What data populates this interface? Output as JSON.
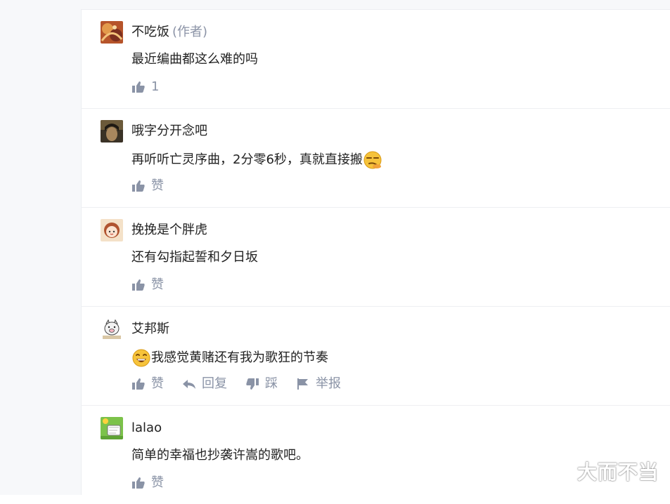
{
  "comments": [
    {
      "name": "不吃饭",
      "author_tag": "(作者)",
      "content": "最近编曲都这么难的吗",
      "like_label": "1",
      "avatar": "orange-abstract-avatar"
    },
    {
      "name": "哦字分开念吧",
      "content": "再听听亡灵序曲，2分零6秒，真就直接搬",
      "content_emoji": "smirk-emoji",
      "like_label": "赞",
      "avatar": "dark-portrait-avatar"
    },
    {
      "name": "挽挽是个胖虎",
      "content": "还有勾指起誓和夕日坂",
      "like_label": "赞",
      "avatar": "girl-cartoon-avatar"
    },
    {
      "name": "艾邦斯",
      "content_emoji": "grin-emoji",
      "content": "我感觉黄赌还有我为歌狂的节奏",
      "like_label": "赞",
      "reply_label": "回复",
      "dislike_label": "踩",
      "report_label": "举报",
      "avatar": "pig-avatar"
    },
    {
      "name": "lalao",
      "content": "简单的幸福也抄袭许嵩的歌吧。",
      "like_label": "赞",
      "avatar": "green-cartoon-avatar"
    }
  ],
  "watermark": "大而不当",
  "colors": {
    "text": "#222222",
    "muted": "#8a93a6",
    "divider": "#eeeff2"
  }
}
